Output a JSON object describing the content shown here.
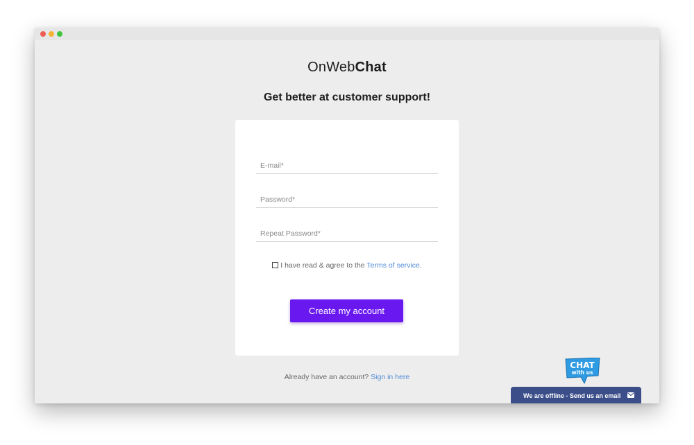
{
  "window": {
    "controls": [
      "close",
      "minimize",
      "maximize"
    ]
  },
  "brand": {
    "logo_light": "OnWeb",
    "logo_bold": "Chat"
  },
  "tagline": "Get better at customer support!",
  "form": {
    "email_placeholder": "E-mail*",
    "password_placeholder": "Password*",
    "repeat_password_placeholder": "Repeat Password*",
    "terms_prefix": "I have read & agree to the ",
    "terms_link": "Terms of service",
    "terms_suffix": ".",
    "submit_label": "Create my account"
  },
  "signin": {
    "prefix": "Already have an account? ",
    "link": "Sign in here"
  },
  "chat_widget": {
    "badge_line1": "CHAT",
    "badge_line2": "with us",
    "status_text": "We are offline - Send us an email",
    "icon": "envelope-icon"
  },
  "colors": {
    "accent": "#6a18f0",
    "link": "#4e8ad8",
    "chat_bar": "#3b4e89",
    "badge": "#2e9be3"
  }
}
